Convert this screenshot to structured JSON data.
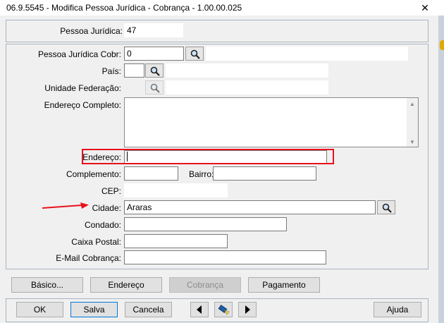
{
  "window": {
    "title": "06.9.5545 - Modifica Pessoa Jurídica - Cobrança - 1.00.00.025",
    "close_label": "✕"
  },
  "header": {
    "pessoa_juridica_label": "Pessoa Jurídica:",
    "pessoa_juridica_value": "47"
  },
  "form": {
    "pj_cobr_label": "Pessoa Jurídica Cobr:",
    "pj_cobr_value": "0",
    "pais_label": "País:",
    "pais_value": "",
    "uf_label": "Unidade Federação:",
    "uf_value": "",
    "endereco_completo_label": "Endereço Completo:",
    "endereco_completo_value": "",
    "endereco_label": "Endereço:",
    "endereco_value": "",
    "complemento_label": "Complemento:",
    "complemento_value": "",
    "bairro_label": "Bairro:",
    "bairro_value": "",
    "cep_label": "CEP:",
    "cep_value": "",
    "cidade_label": "Cidade:",
    "cidade_value": "Araras",
    "condado_label": "Condado:",
    "condado_value": "",
    "caixa_postal_label": "Caixa Postal:",
    "caixa_postal_value": "",
    "email_cobranca_label": "E-Mail Cobrança:",
    "email_cobranca_value": ""
  },
  "tabs": {
    "basico": "Básico...",
    "endereco": "Endereço",
    "cobranca": "Cobrança",
    "pagamento": "Pagamento"
  },
  "footer": {
    "ok": "OK",
    "salva": "Salva",
    "cancela": "Cancela",
    "ajuda": "Ajuda"
  },
  "colors": {
    "highlight": "#e8121b",
    "arrow": "#e8121b",
    "focus_border": "#0078d7"
  }
}
